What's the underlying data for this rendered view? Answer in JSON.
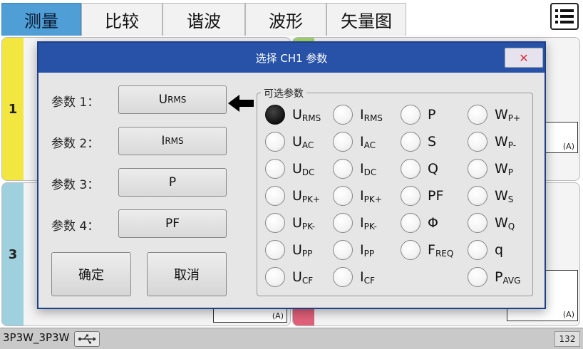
{
  "tabs": [
    {
      "label": "测量",
      "active": true
    },
    {
      "label": "比较",
      "active": false
    },
    {
      "label": "谐波",
      "active": false
    },
    {
      "label": "波形",
      "active": false
    },
    {
      "label": "矢量图",
      "active": false
    }
  ],
  "menu_icon": "menu-list-icon",
  "channels": {
    "ch1": {
      "number": "1",
      "unit": "(A)"
    },
    "ch3": {
      "number": "3",
      "unit": "(A)"
    },
    "ch4_unit": "(A)"
  },
  "status": {
    "mode": "3P3W_3P3W",
    "usb_icon": "usb-icon",
    "page": "132"
  },
  "dialog": {
    "title": "选择 CH1 参数",
    "close": "✕",
    "params": [
      {
        "label": "参数 1：",
        "main": "U",
        "sub": "RMS"
      },
      {
        "label": "参数 2：",
        "main": "I",
        "sub": "RMS"
      },
      {
        "label": "参数 3：",
        "main": "P",
        "sub": ""
      },
      {
        "label": "参数 4：",
        "main": "PF",
        "sub": ""
      }
    ],
    "confirm": "确定",
    "cancel": "取消",
    "group_title": "可选参数",
    "options": [
      [
        {
          "main": "U",
          "sub": "RMS",
          "checked": true
        },
        {
          "main": "I",
          "sub": "RMS"
        },
        {
          "main": "P",
          "sub": ""
        },
        {
          "main": "W",
          "sub": "P+"
        }
      ],
      [
        {
          "main": "U",
          "sub": "AC"
        },
        {
          "main": "I",
          "sub": "AC"
        },
        {
          "main": "S",
          "sub": ""
        },
        {
          "main": "W",
          "sub": "P-"
        }
      ],
      [
        {
          "main": "U",
          "sub": "DC"
        },
        {
          "main": "I",
          "sub": "DC"
        },
        {
          "main": "Q",
          "sub": ""
        },
        {
          "main": "W",
          "sub": "P"
        }
      ],
      [
        {
          "main": "U",
          "sub": "PK+"
        },
        {
          "main": "I",
          "sub": "PK+"
        },
        {
          "main": "PF",
          "sub": ""
        },
        {
          "main": "W",
          "sub": "S"
        }
      ],
      [
        {
          "main": "U",
          "sub": "PK-"
        },
        {
          "main": "I",
          "sub": "PK-"
        },
        {
          "main": "Φ",
          "sub": ""
        },
        {
          "main": "W",
          "sub": "Q"
        }
      ],
      [
        {
          "main": "U",
          "sub": "PP"
        },
        {
          "main": "I",
          "sub": "PP"
        },
        {
          "main": "F",
          "sub": "REQ"
        },
        {
          "main": "q",
          "sub": ""
        }
      ],
      [
        {
          "main": "U",
          "sub": "CF"
        },
        {
          "main": "I",
          "sub": "CF"
        },
        null,
        {
          "main": "P",
          "sub": "AVG"
        }
      ]
    ]
  }
}
